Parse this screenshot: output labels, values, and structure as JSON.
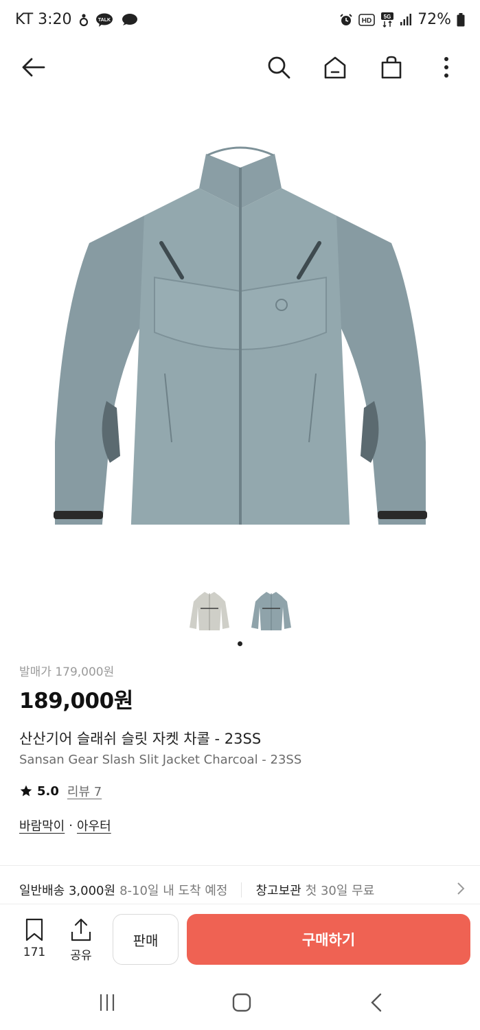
{
  "status_bar": {
    "carrier_time": "KT 3:20",
    "battery": "72%"
  },
  "nav": {
    "icons": [
      "back-arrow-icon",
      "search-icon",
      "home-icon",
      "shopping-bag-icon",
      "more-vert-icon"
    ]
  },
  "product": {
    "image_color": "#8fa3aa",
    "thumbnails": [
      {
        "color": "#cfcfc8",
        "selected": false
      },
      {
        "color": "#8fa3aa",
        "selected": true
      }
    ],
    "release_price": "발매가 179,000원",
    "price": "189,000원",
    "name_ko": "산산기어 슬래쉬 슬릿 자켓 차콜 - 23SS",
    "name_en": "Sansan Gear Slash Slit Jacket Charcoal - 23SS",
    "rating": "5.0",
    "review_label": "리뷰 7",
    "category_1": "바람막이",
    "category_sep": "·",
    "category_2": "아우터"
  },
  "shipping": {
    "main": "일반배송 3,000원",
    "sub": "8-10일 내 도착 예정",
    "storage_main": "창고보관",
    "storage_sub": "첫 30일 무료"
  },
  "actions": {
    "bookmark_count": "171",
    "share_label": "공유",
    "sell_label": "판매",
    "buy_label": "구매하기",
    "buy_color": "#ef6253"
  }
}
